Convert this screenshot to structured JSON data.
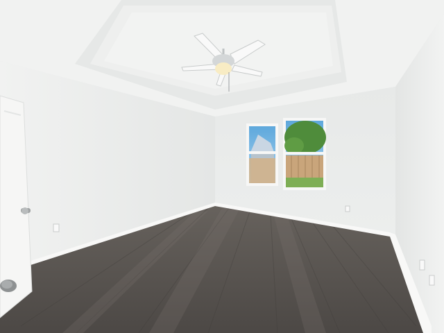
{
  "scene": {
    "subject": "empty-bedroom",
    "palette": {
      "wall_light": "#eeefee",
      "wall_shadow": "#d9dcdb",
      "ceiling": "#f3f4f3",
      "tray_ceiling": "#ecedec",
      "floor_dark": "#4d4a48",
      "floor_mid": "#5f5b57",
      "baseboard": "#f7f7f6",
      "door": "#f6f6f5",
      "sky": "#6fb2e0",
      "trees": "#4f8c3b",
      "fence": "#c9a57b"
    },
    "icons": [
      "ceiling-fan-icon",
      "door-handle-icon",
      "outlet-icon"
    ]
  }
}
